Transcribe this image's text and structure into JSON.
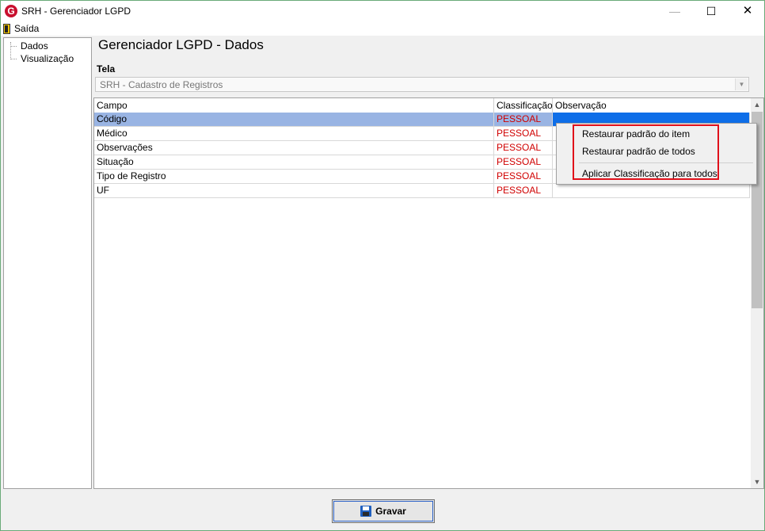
{
  "window": {
    "title": "SRH - Gerenciador LGPD",
    "app_icon_glyph": "G",
    "controls": {
      "minimize": "—",
      "maximize": "☐",
      "close": "✕"
    }
  },
  "menubar": {
    "saida": "Saída"
  },
  "tree": {
    "items": [
      "Dados",
      "Visualização"
    ]
  },
  "main": {
    "heading": "Gerenciador LGPD - Dados",
    "tela_label": "Tela",
    "tela_value": "SRH - Cadastro de Registros"
  },
  "grid": {
    "columns": [
      "Campo",
      "Classificação",
      "Observação"
    ],
    "rows": [
      {
        "campo": "Código",
        "classificacao": "PESSOAL",
        "observacao": "",
        "selected": true
      },
      {
        "campo": "Médico",
        "classificacao": "PESSOAL",
        "observacao": ""
      },
      {
        "campo": "Observações",
        "classificacao": "PESSOAL",
        "observacao": ""
      },
      {
        "campo": "Situação",
        "classificacao": "PESSOAL",
        "observacao": ""
      },
      {
        "campo": "Tipo de Registro",
        "classificacao": "PESSOAL",
        "observacao": ""
      },
      {
        "campo": "UF",
        "classificacao": "PESSOAL",
        "observacao": ""
      }
    ]
  },
  "context_menu": {
    "items": [
      "Restaurar padrão do item",
      "Restaurar padrão de todos",
      "Aplicar Classificação para todos"
    ]
  },
  "footer": {
    "gravar": "Gravar"
  },
  "colors": {
    "selection": "#99b4e3",
    "selection_edit": "#0e6ee8",
    "classification_text": "#d00000",
    "highlight": "#e0101a",
    "frame": "#6aaa78"
  }
}
